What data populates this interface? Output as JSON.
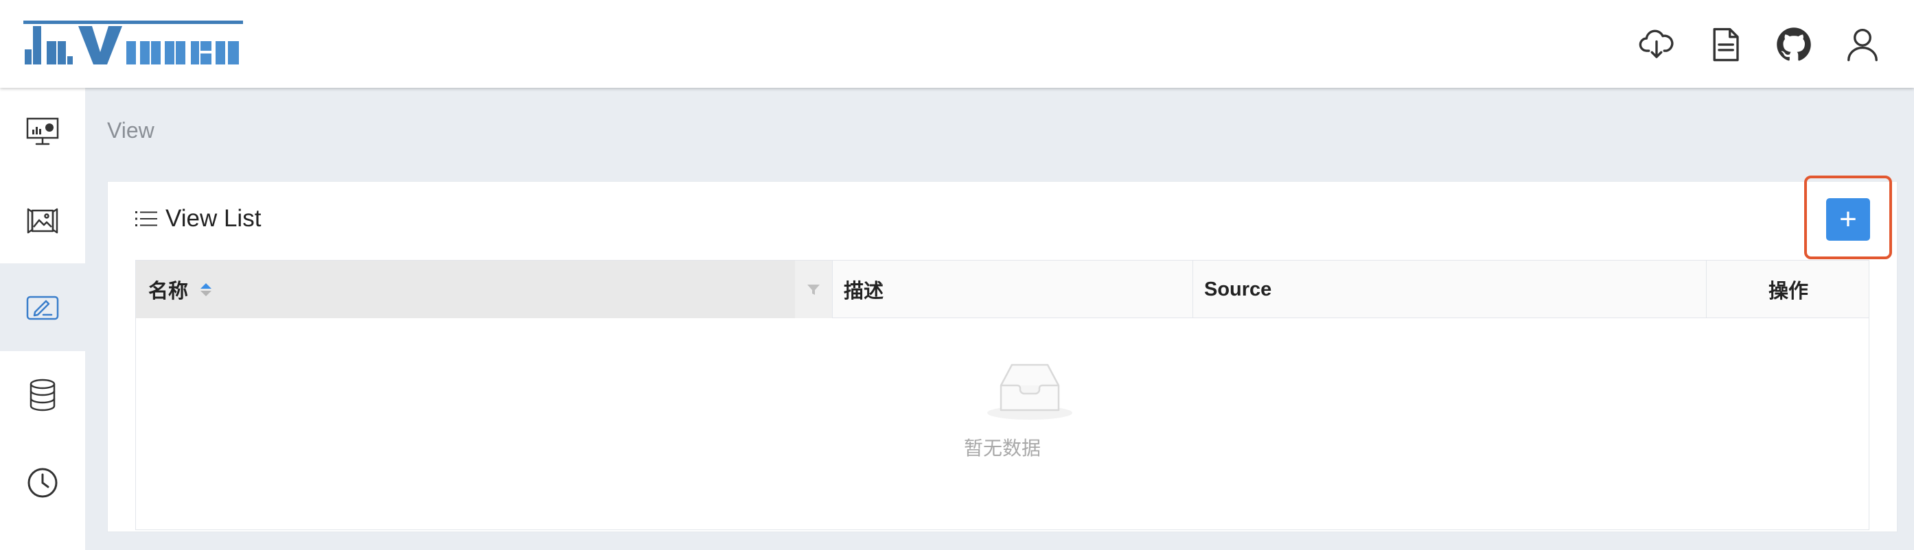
{
  "header": {
    "logo_alt": "davinci",
    "icons": [
      "cloud-download-icon",
      "document-icon",
      "github-icon",
      "user-icon"
    ]
  },
  "sidebar": {
    "items": [
      {
        "icon": "dashboard-monitor-icon",
        "active": false
      },
      {
        "icon": "widget-image-icon",
        "active": false
      },
      {
        "icon": "view-edit-icon",
        "active": true
      },
      {
        "icon": "database-icon",
        "active": false
      },
      {
        "icon": "schedule-clock-icon",
        "active": false
      }
    ]
  },
  "page": {
    "title": "View"
  },
  "panel": {
    "title": "View List",
    "add_button_label": "+"
  },
  "table": {
    "columns": [
      "名称",
      "描述",
      "Source",
      "操作"
    ],
    "rows": [],
    "empty_text": "暂无数据"
  },
  "colors": {
    "accent": "#3a8ee6",
    "highlight_frame": "#e2572f",
    "logo_blue": "#3f7db8"
  }
}
